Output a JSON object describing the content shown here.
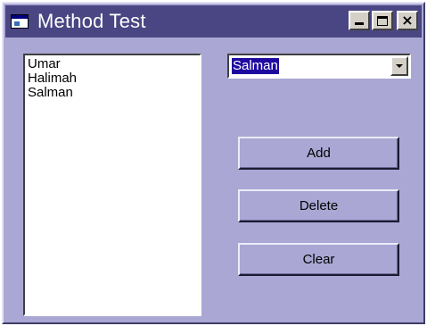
{
  "window": {
    "title": "Method Test",
    "controls": {
      "minimize": "minimize",
      "maximize": "maximize",
      "close": "close"
    }
  },
  "listbox": {
    "items": [
      "Umar",
      "Halimah",
      "Salman"
    ]
  },
  "combo": {
    "selected_value": "Salman"
  },
  "buttons": {
    "add_label": "Add",
    "delete_label": "Delete",
    "clear_label": "Clear"
  },
  "colors": {
    "titlebar": "#4a4683",
    "form_background": "#aaa7d4",
    "selection_highlight": "#1f0aa0"
  }
}
